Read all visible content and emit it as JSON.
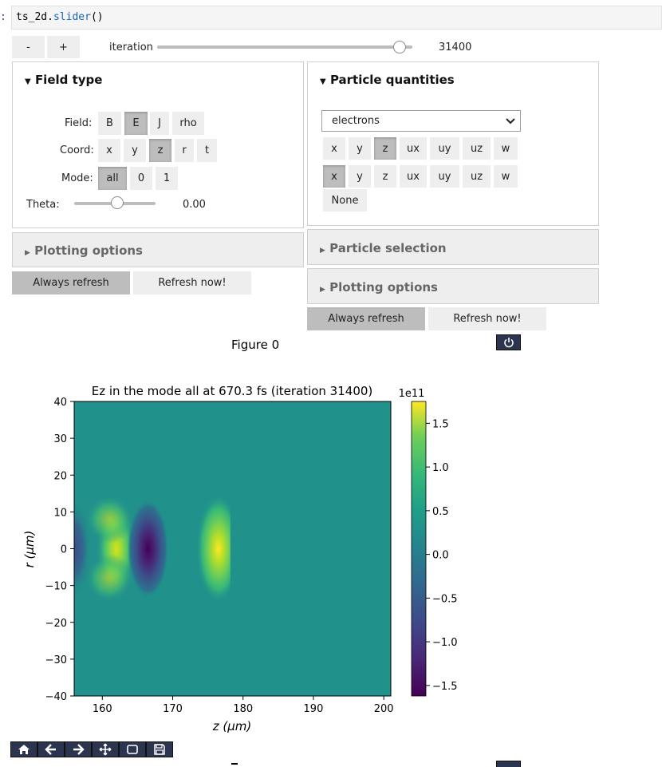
{
  "cell": {
    "prompt": ":",
    "code_obj": "ts_2d.",
    "code_fn": "slider",
    "code_tail": "()"
  },
  "top": {
    "minus": "-",
    "plus": "+",
    "iteration_label": "iteration",
    "iteration_value": "31400",
    "iteration_fraction": 0.95
  },
  "field": {
    "title": "Field type",
    "field_label": "Field:",
    "field_opts": [
      "B",
      "E",
      "J",
      "rho"
    ],
    "coord_label": "Coord:",
    "coord_opts": [
      "x",
      "y",
      "z",
      "r",
      "t"
    ],
    "mode_label": "Mode:",
    "mode_opts": [
      "all",
      "0",
      "1"
    ],
    "theta_label": "Theta:",
    "theta_value": "0.00",
    "plotting_options": "Plotting options",
    "always_refresh": "Always refresh",
    "refresh_now": "Refresh now!"
  },
  "particle": {
    "title": "Particle quantities",
    "species": "electrons",
    "row1": [
      "x",
      "y",
      "z",
      "ux",
      "uy",
      "uz",
      "w"
    ],
    "row2": [
      "x",
      "y",
      "z",
      "ux",
      "uy",
      "uz",
      "w"
    ],
    "none": "None",
    "particle_selection": "Particle selection",
    "plotting_options": "Plotting options",
    "always_refresh": "Always refresh",
    "refresh_now": "Refresh now!"
  },
  "figure_label": "Figure 0",
  "icons": {
    "power": "power-icon",
    "home": "home-icon",
    "back": "arrow-left-icon",
    "forward": "arrow-right-icon",
    "pan": "move-icon",
    "zoom": "zoom-rect-icon",
    "save": "save-icon"
  },
  "chart_data": {
    "type": "heatmap",
    "title": "Ez in the mode all at 670.3 fs   (iteration 31400)",
    "xlabel": "z (μm)",
    "ylabel": "r (μm)",
    "xlim": [
      156,
      201
    ],
    "ylim": [
      -40,
      40
    ],
    "x_ticks": [
      "160",
      "170",
      "180",
      "190",
      "200"
    ],
    "y_ticks": [
      "40",
      "30",
      "20",
      "10",
      "0",
      "−10",
      "−20",
      "−30",
      "−40"
    ],
    "colorbar": {
      "multiplier": "1e11",
      "ticks": [
        "1.5",
        "1.0",
        "0.5",
        "0.0",
        "−0.5",
        "−1.0",
        "−1.5"
      ],
      "range": [
        -1.62,
        1.75
      ],
      "colormap": "viridis"
    },
    "features": [
      {
        "z": 162,
        "r": 0,
        "sign": "positive",
        "relative_amplitude": 0.75
      },
      {
        "z": 166.5,
        "r": 0,
        "sign": "negative",
        "relative_amplitude": 1.0
      },
      {
        "z": 176.5,
        "r": 0,
        "sign": "positive",
        "relative_amplitude": 1.0
      },
      {
        "z": 156,
        "r": 0,
        "sign": "negative",
        "relative_amplitude": 0.5
      }
    ],
    "field_front_z": 178.2
  }
}
